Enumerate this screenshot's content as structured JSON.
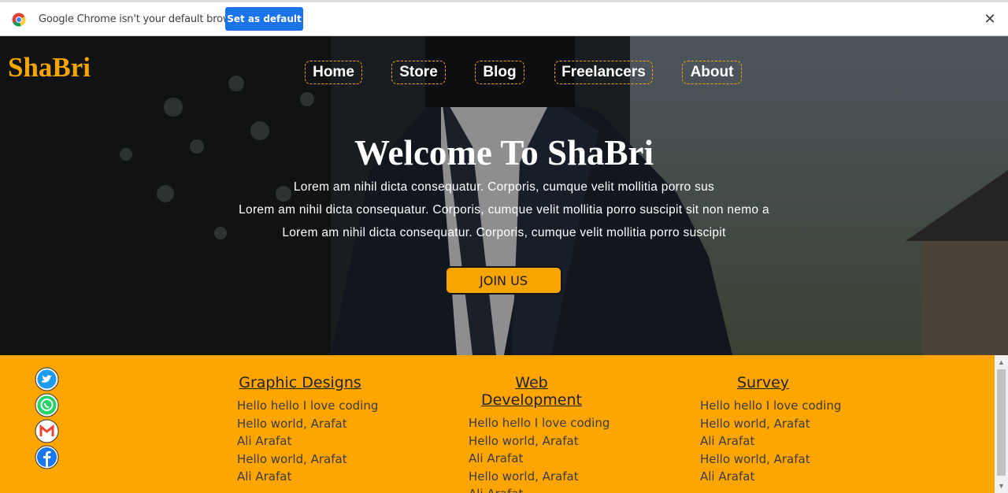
{
  "infobar": {
    "message": "Google Chrome isn't your default browser",
    "button_label": "Set as default",
    "close_glyph": "✕",
    "icon": "chrome-icon"
  },
  "site": {
    "logo": "ShaBri",
    "brand_color": "#f5a400"
  },
  "nav": [
    {
      "label": "Home"
    },
    {
      "label": "Store"
    },
    {
      "label": "Blog"
    },
    {
      "label": "Freelancers"
    },
    {
      "label": "About"
    }
  ],
  "hero": {
    "title": "Welcome To ShaBri",
    "lines": [
      "Lorem am nihil dicta consequatur. Corporis, cumque velit mollitia porro sus",
      "Lorem am nihil dicta consequatur. Corporis, cumque velit mollitia porro suscipit sit non nemo a",
      "Lorem am nihil dicta consequatur. Corporis, cumque velit mollitia porro suscipit"
    ],
    "cta": "JOIN US"
  },
  "social": [
    {
      "icon": "twitter-icon",
      "color": "#1d9bf0"
    },
    {
      "icon": "whatsapp-icon",
      "color": "#25d366"
    },
    {
      "icon": "gmail-icon",
      "color": "#ea4335"
    },
    {
      "icon": "facebook-icon",
      "color": "#1877f2"
    }
  ],
  "footer": {
    "columns": [
      {
        "title": "Graphic Designs",
        "items": [
          "Hello hello I love coding",
          "Hello world, Arafat",
          "Ali Arafat",
          "Hello world, Arafat",
          "Ali Arafat"
        ]
      },
      {
        "title": "Web Development",
        "items": [
          "Hello hello I love coding",
          "Hello world, Arafat",
          "Ali Arafat",
          "Hello world, Arafat",
          "Ali Arafat"
        ]
      },
      {
        "title": "Survey",
        "items": [
          "Hello hello I love coding",
          "Hello world, Arafat",
          "Ali Arafat",
          "Hello world, Arafat",
          "Ali Arafat"
        ]
      }
    ],
    "background": "#ffa500"
  }
}
